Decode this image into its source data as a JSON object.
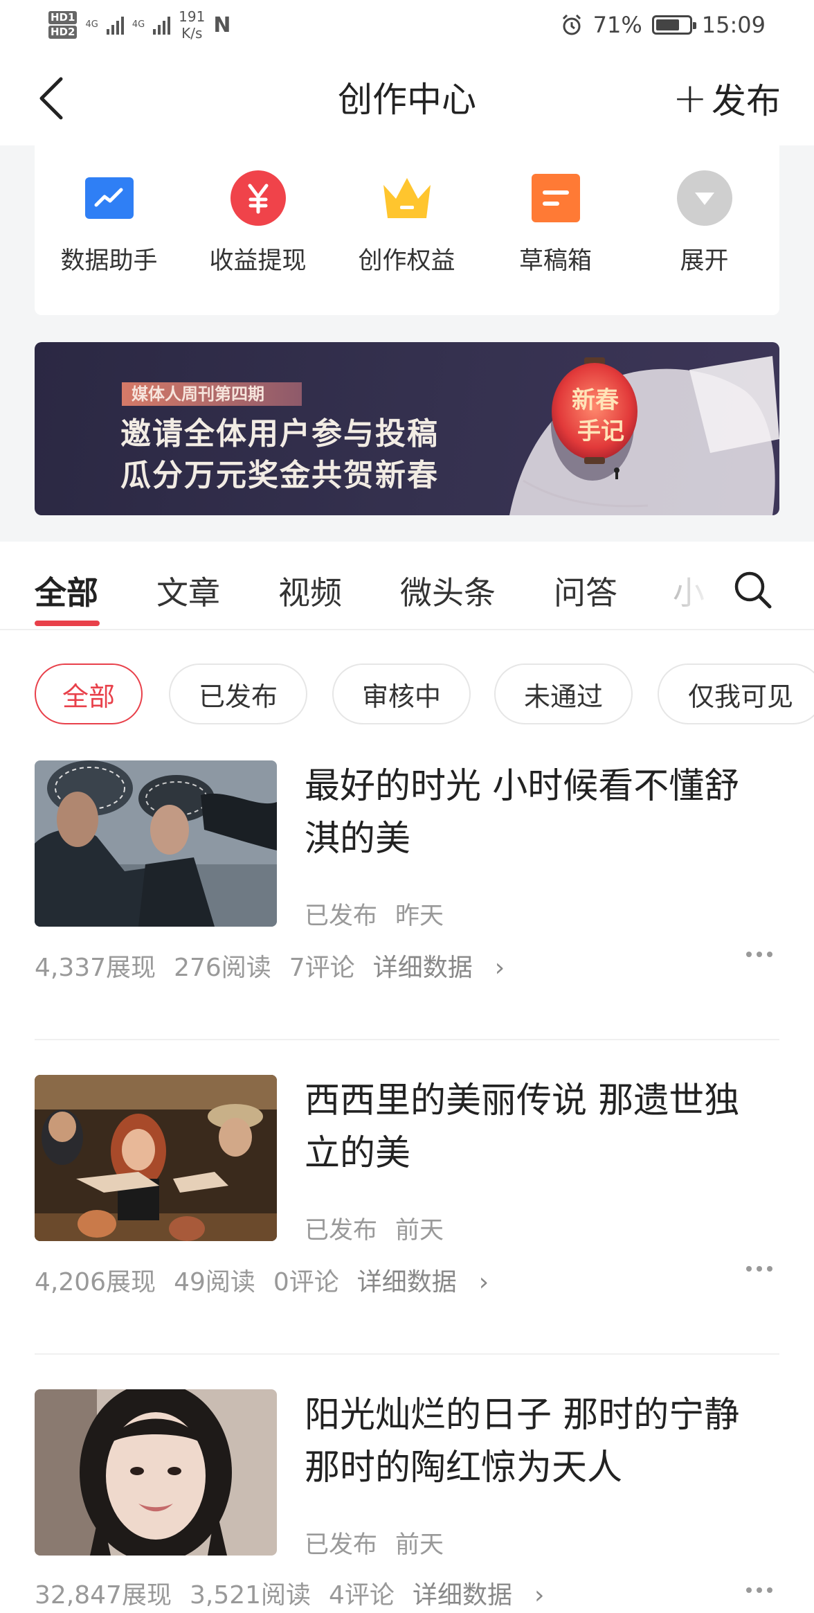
{
  "status_bar": {
    "hd1": "HD1",
    "hd2": "HD2",
    "net1": "4G",
    "net2": "4G",
    "speed_value": "191",
    "speed_unit": "K/s",
    "nfc": "N",
    "battery": "71%",
    "battery_level": 0.71,
    "time": "15:09"
  },
  "nav": {
    "title": "创作中心",
    "publish_label": "发布",
    "publish_prefix": "+"
  },
  "tools": [
    {
      "label": "数据助手",
      "icon": "chart-icon",
      "color": "#2f7ff5"
    },
    {
      "label": "收益提现",
      "icon": "yuan-icon",
      "color": "#f0434a"
    },
    {
      "label": "创作权益",
      "icon": "crown-icon",
      "color": "#ffc52e"
    },
    {
      "label": "草稿箱",
      "icon": "draft-icon",
      "color": "#ff7a35"
    },
    {
      "label": "展开",
      "icon": "expand-icon",
      "color": "#cfcfcf"
    }
  ],
  "banner": {
    "tag": "媒体人周刊第四期",
    "line1": "邀请全体用户参与投稿",
    "line2": "瓜分万元奖金共贺新春",
    "art_text_1": "新春",
    "art_text_2": "手记"
  },
  "tabs": {
    "items": [
      "全部",
      "文章",
      "视频",
      "微头条",
      "问答",
      "小"
    ],
    "active": "全部"
  },
  "filters": {
    "items": [
      "全部",
      "已发布",
      "审核中",
      "未通过",
      "仅我可见"
    ],
    "active": "全部"
  },
  "articles": [
    {
      "title": "最好的时光 小时候看不懂舒淇的美",
      "status": "已发布",
      "date": "昨天",
      "views": "4,337展现",
      "reads": "276阅读",
      "comments": "7评论",
      "detail": "详细数据",
      "thumb_palette": [
        "#36414d",
        "#8f9aa6"
      ]
    },
    {
      "title": "西西里的美丽传说 那遗世独立的美",
      "status": "已发布",
      "date": "前天",
      "views": "4,206展现",
      "reads": "49阅读",
      "comments": "0评论",
      "detail": "详细数据",
      "thumb_palette": [
        "#3a2a1c",
        "#c8a070"
      ]
    },
    {
      "title": "阳光灿烂的日子 那时的宁静 那时的陶红惊为天人",
      "status": "已发布",
      "date": "前天",
      "views": "32,847展现",
      "reads": "3,521阅读",
      "comments": "4评论",
      "detail": "详细数据",
      "thumb_palette": [
        "#b7a99f",
        "#efe6e0"
      ]
    }
  ],
  "colors": {
    "accent": "#e8404a",
    "text_primary": "#222222",
    "text_secondary": "#999999",
    "page_grey": "#f4f5f6"
  }
}
